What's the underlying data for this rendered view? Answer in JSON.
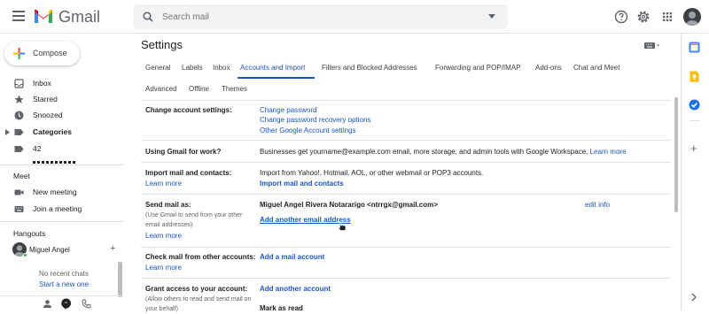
{
  "header": {
    "app_name": "Gmail",
    "search_placeholder": "Search mail"
  },
  "compose": {
    "label": "Compose"
  },
  "nav": {
    "items": [
      {
        "label": "Inbox",
        "bold": false
      },
      {
        "label": "Starred",
        "bold": false
      },
      {
        "label": "Snoozed",
        "bold": false
      },
      {
        "label": "Categories",
        "bold": true
      },
      {
        "label": "42",
        "bold": false
      }
    ]
  },
  "meet": {
    "title": "Meet",
    "new_meeting": "New meeting",
    "join_meeting": "Join a meeting"
  },
  "hangouts": {
    "title": "Hangouts",
    "user": "Miguel Angel",
    "no_chats": "No recent chats",
    "start_new": "Start a new one"
  },
  "settings": {
    "title": "Settings",
    "tabs": [
      "General",
      "Labels",
      "Inbox",
      "Accounts and Import",
      "Filters and Blocked Addresses",
      "Forwarding and POP/IMAP",
      "Add-ons",
      "Chat and Meet",
      "Advanced",
      "Offline",
      "Themes"
    ],
    "active_tab": "Accounts and Import",
    "rows": {
      "change_account": {
        "label": "Change account settings:",
        "links": [
          "Change password",
          "Change password recovery options",
          "Other Google Account settings"
        ]
      },
      "work": {
        "label": "Using Gmail for work?",
        "text": "Businesses get yourname@example.com email, more storage, and admin tools with Google Workspace.",
        "link": "Learn more"
      },
      "import": {
        "label": "Import mail and contacts:",
        "learn_more": "Learn more",
        "text": "Import from Yahoo!, Hotmail, AOL, or other webmail or POP3 accounts.",
        "action": "Import mail and contacts"
      },
      "send_as": {
        "label": "Send mail as:",
        "sub1": "(Use Gmail to send from your other",
        "sub2": "email addresses)",
        "learn_more": "Learn more",
        "identity": "Miguel Angel Rivera Notararigo <ntrrgx@gmail.com>",
        "edit": "edit info",
        "add": "Add another email address"
      },
      "check_mail": {
        "label": "Check mail from other accounts:",
        "learn_more": "Learn more",
        "action": "Add a mail account"
      },
      "grant": {
        "label": "Grant access to your account:",
        "sub1": "(Allow others to read and send mail on",
        "sub2": "your behalf)",
        "action": "Add another account",
        "mark": "Mark as read"
      }
    }
  },
  "colors": {
    "link": "#1a57c8",
    "gmail_red": "#ea4335",
    "gmail_blue": "#4285f4",
    "gmail_green": "#34a853",
    "gmail_yellow": "#fbbc04"
  }
}
